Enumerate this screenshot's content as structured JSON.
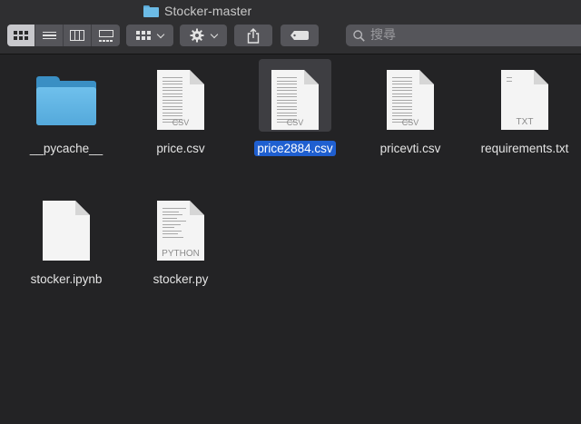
{
  "window": {
    "title": "Stocker-master",
    "title_icon": "folder-icon"
  },
  "toolbar": {
    "view_modes": [
      {
        "name": "icon-view",
        "icon": "grid-icon",
        "active": true
      },
      {
        "name": "list-view",
        "icon": "list-icon",
        "active": false
      },
      {
        "name": "column-view",
        "icon": "columns-icon",
        "active": false
      },
      {
        "name": "gallery-view",
        "icon": "gallery-icon",
        "active": false
      }
    ],
    "group_icon": "grid-icon",
    "action_icon": "gear-icon",
    "share_icon": "share-icon",
    "tag_icon": "tag-icon",
    "search": {
      "placeholder": "搜尋",
      "value": ""
    }
  },
  "files": [
    {
      "name": "__pycache__",
      "kind": "folder",
      "selected": false
    },
    {
      "name": "price.csv",
      "kind": "csv",
      "badge": "CSV",
      "selected": false
    },
    {
      "name": "price2884.csv",
      "kind": "csv",
      "badge": "CSV",
      "selected": true
    },
    {
      "name": "pricevti.csv",
      "kind": "csv",
      "badge": "CSV",
      "selected": false
    },
    {
      "name": "requirements.txt",
      "kind": "txt",
      "badge": "TXT",
      "selected": false
    },
    {
      "name": "stocker.ipynb",
      "kind": "blank",
      "badge": "",
      "selected": false
    },
    {
      "name": "stocker.py",
      "kind": "python",
      "badge": "PYTHON",
      "selected": false
    }
  ],
  "colors": {
    "background": "#232325",
    "selection": "#1f5fd0",
    "folder": "#6fc0ec"
  }
}
